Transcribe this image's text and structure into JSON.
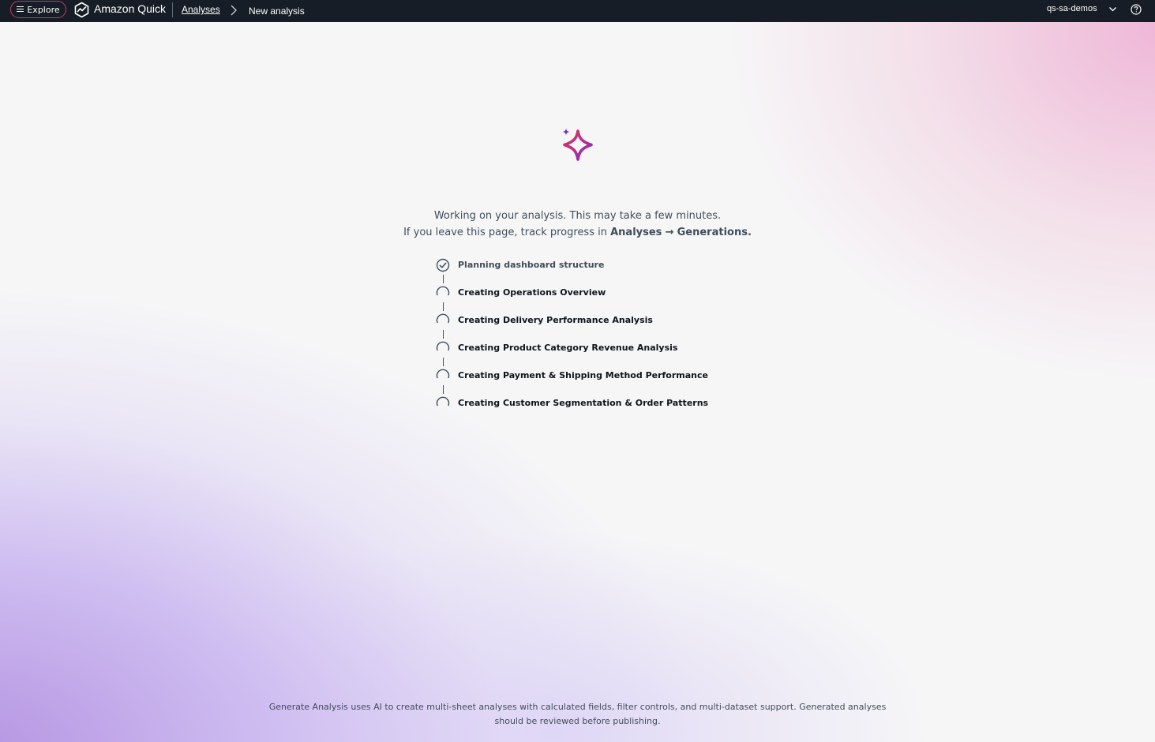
{
  "nav": {
    "explore_label": "Explore",
    "brand": "Amazon Quick",
    "breadcrumb_link": "Analyses",
    "breadcrumb_current": "New analysis",
    "account": "qs-sa-demos",
    "icons": [
      "menu-icon",
      "amazon-quick-logo-icon",
      "chevron-right-icon",
      "chevron-down-icon",
      "help-icon"
    ]
  },
  "main": {
    "status_line1": "Working on your analysis. This may take a few minutes.",
    "status_line2_prefix": "If you leave this page, track progress in",
    "status_line2_analyses": "Analyses",
    "status_line2_arrow": "→",
    "status_line2_generations": "Generations.",
    "steps": [
      {
        "label": "Planning dashboard structure",
        "state": "done"
      },
      {
        "label": "Creating Operations Overview",
        "state": "in-progress"
      },
      {
        "label": "Creating Delivery Performance Analysis",
        "state": "in-progress"
      },
      {
        "label": "Creating Product Category Revenue Analysis",
        "state": "in-progress"
      },
      {
        "label": "Creating Payment & Shipping Method Performance",
        "state": "in-progress"
      },
      {
        "label": "Creating Customer Segmentation & Order Patterns",
        "state": "in-progress"
      }
    ]
  },
  "footer": {
    "line1": "Generate Analysis uses AI to create multi-sheet analyses with calculated fields, filter controls, and multi-dataset support. Generated analyses",
    "line2": "should be reviewed before publishing."
  },
  "colors": {
    "topbar": "#161d26",
    "explore_border": "#c73a6c",
    "sparkle_start": "#e0345a",
    "sparkle_end": "#7a2bd0",
    "text": "#414d5c"
  }
}
